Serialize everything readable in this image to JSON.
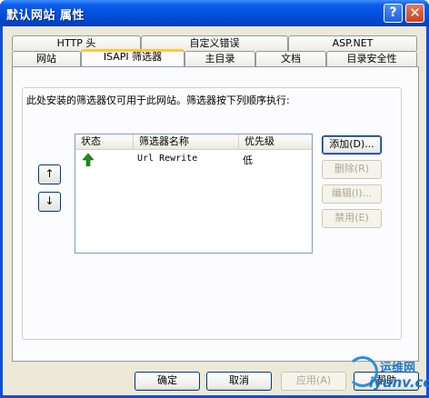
{
  "window": {
    "title": "默认网站 属性",
    "help_glyph": "?",
    "close_glyph": "✕"
  },
  "tabs_back": [
    {
      "label": "HTTP 头"
    },
    {
      "label": "自定义错误"
    },
    {
      "label": "ASP.NET"
    }
  ],
  "tabs_front": [
    {
      "label": "网站"
    },
    {
      "label": "ISAPI 筛选器"
    },
    {
      "label": "主目录"
    },
    {
      "label": "文档"
    },
    {
      "label": "目录安全性"
    }
  ],
  "panel": {
    "description": "此处安装的筛选器仅可用于此网站。筛选器按下列顺序执行:",
    "columns": [
      "状态",
      "筛选器名称",
      "优先级"
    ],
    "rows": [
      {
        "status_icon": "green-up-arrow-icon",
        "name": "Url Rewrite",
        "priority": "低"
      }
    ],
    "move_up_glyph": "↑",
    "move_down_glyph": "↓",
    "side_buttons": {
      "add": "添加(D)...",
      "remove": "删除(R)",
      "edit": "编辑(I)...",
      "disable": "禁用(E)"
    }
  },
  "footer": {
    "ok": "确定",
    "cancel": "取消",
    "apply": "应用(A)",
    "help": "帮助"
  },
  "watermark": {
    "line1": "运维网",
    "line2": "iyunv.com"
  },
  "colors": {
    "titlebar": "#0052e0",
    "active_tab_accent": "#ffc83c",
    "status_arrow": "#1a8f1a"
  }
}
